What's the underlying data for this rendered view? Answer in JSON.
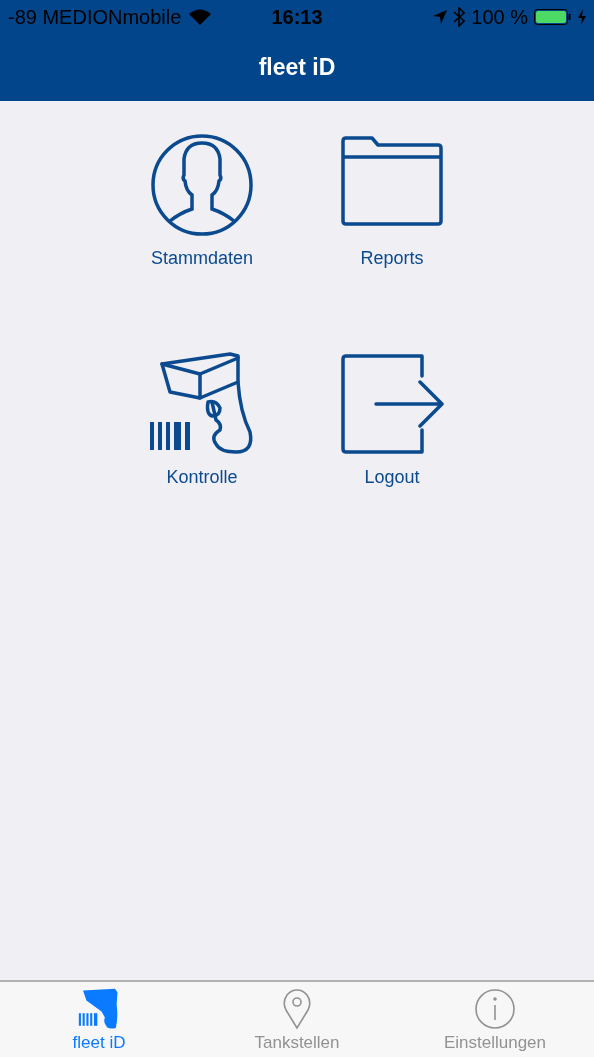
{
  "status_bar": {
    "carrier": "-89 MEDIONmobile",
    "time": "16:13",
    "battery": "100 %"
  },
  "nav_bar": {
    "title": "fleet iD"
  },
  "tiles": [
    {
      "kind": "person",
      "label": "Stammdaten"
    },
    {
      "kind": "folder",
      "label": "Reports"
    },
    {
      "kind": "scanner",
      "label": "Kontrolle"
    },
    {
      "kind": "logout",
      "label": "Logout"
    }
  ],
  "tab_bar": [
    {
      "kind": "scanner",
      "label": "fleet iD",
      "selected": true
    },
    {
      "kind": "pin",
      "label": "Tankstellen",
      "selected": false
    },
    {
      "kind": "info",
      "label": "Einstellungen",
      "selected": false
    }
  ]
}
